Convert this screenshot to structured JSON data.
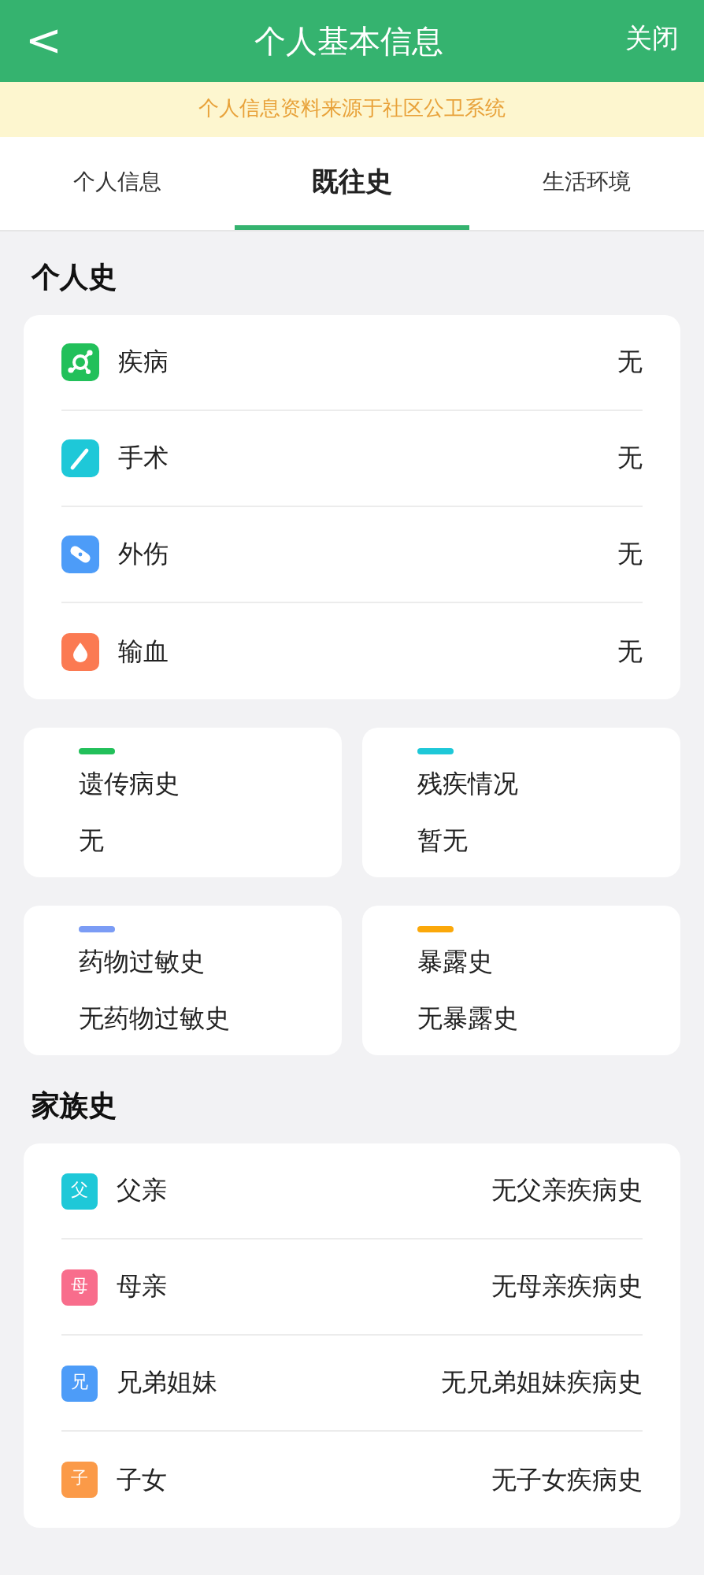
{
  "header": {
    "back": "<",
    "title": "个人基本信息",
    "close": "关闭"
  },
  "notice": "个人信息资料来源于社区公卫系统",
  "tabs": [
    {
      "label": "个人信息",
      "selected": false
    },
    {
      "label": "既往史",
      "selected": true
    },
    {
      "label": "生活环境",
      "selected": false
    }
  ],
  "personal_history": {
    "title": "个人史",
    "items": [
      {
        "kind": "virus",
        "color": "#22c05a",
        "label": "疾病",
        "value": "无"
      },
      {
        "kind": "scalpel",
        "color": "#1ec8d8",
        "label": "手术",
        "value": "无"
      },
      {
        "kind": "bandage",
        "color": "#4d9cf8",
        "label": "外伤",
        "value": "无"
      },
      {
        "kind": "drop",
        "color": "#fb7a52",
        "label": "输血",
        "value": "无"
      }
    ]
  },
  "history_cards": [
    {
      "color": "#22c05a",
      "label": "遗传病史",
      "value": "无"
    },
    {
      "color": "#1ec8d8",
      "label": "残疾情况",
      "value": "暂无"
    },
    {
      "color": "#7b9cf5",
      "label": "药物过敏史",
      "value": "无药物过敏史"
    },
    {
      "color": "#fba80a",
      "label": "暴露史",
      "value": "无暴露史"
    }
  ],
  "family_history": {
    "title": "家族史",
    "items": [
      {
        "badge": "父",
        "color": "#1ec8d8",
        "label": "父亲",
        "value": "无父亲疾病史"
      },
      {
        "badge": "母",
        "color": "#f86d8c",
        "label": "母亲",
        "value": "无母亲疾病史"
      },
      {
        "badge": "兄",
        "color": "#4d9cf8",
        "label": "兄弟姐妹",
        "value": "无兄弟姐妹疾病史"
      },
      {
        "badge": "子",
        "color": "#fb9a48",
        "label": "子女",
        "value": "无子女疾病史"
      }
    ]
  }
}
